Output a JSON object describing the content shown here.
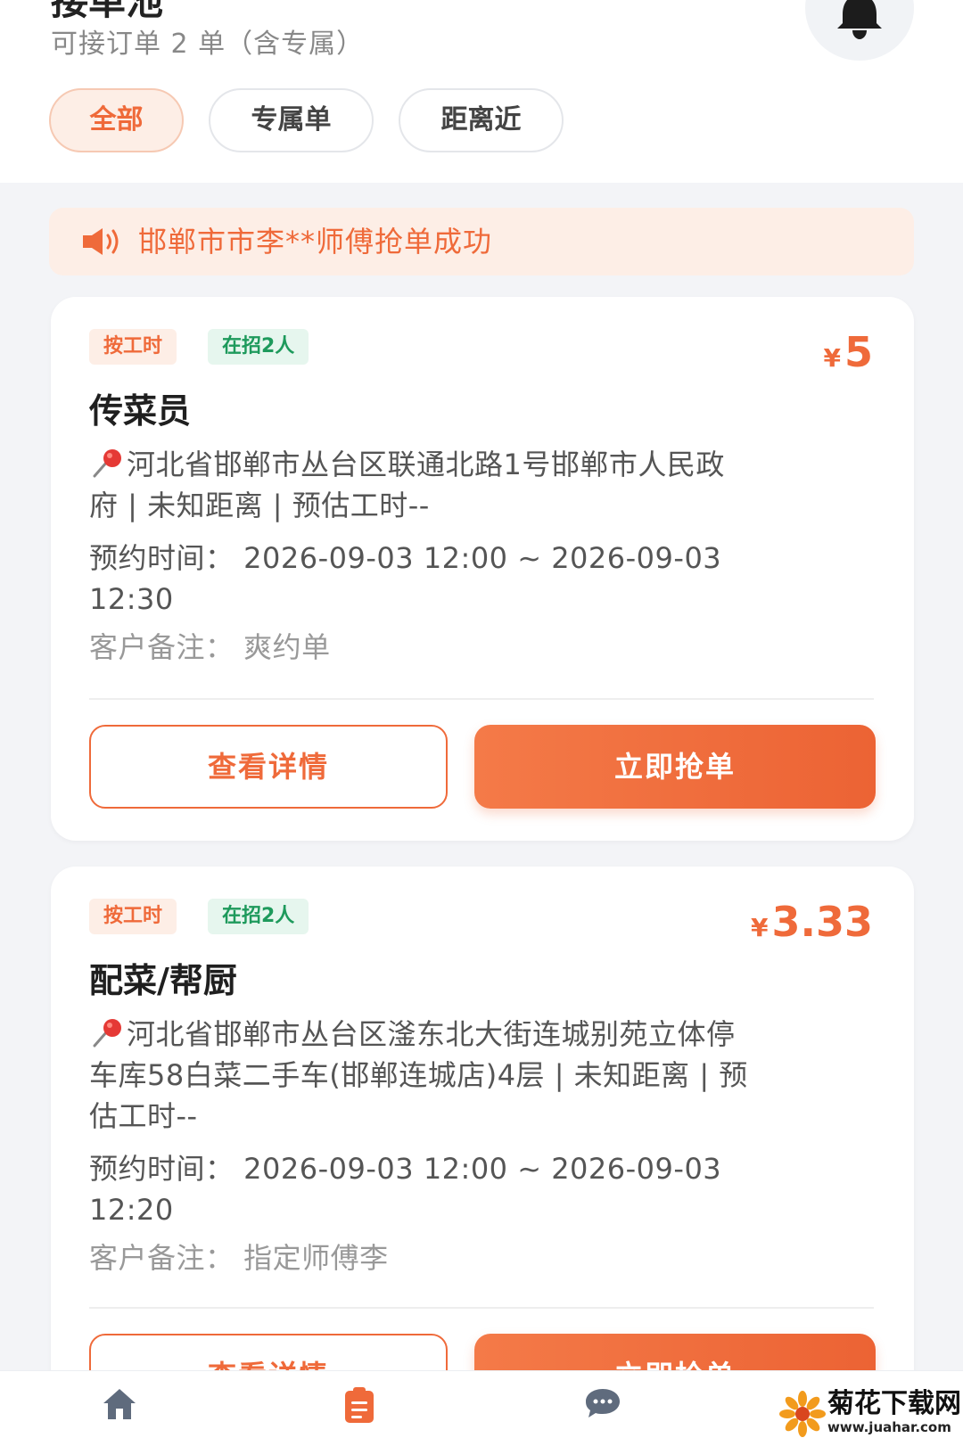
{
  "header": {
    "title": "接单池",
    "subtitle": "可接订单 2 单（含专属）",
    "bell_icon": "bell-icon",
    "filters": [
      {
        "label": "全部",
        "active": true
      },
      {
        "label": "专属单",
        "active": false
      },
      {
        "label": "距离近",
        "active": false
      }
    ]
  },
  "notice": {
    "icon": "speaker-icon",
    "text": "邯郸市市李**师傅抢单成功"
  },
  "orders": [
    {
      "tag_type": "按工时",
      "tag_hiring": "在招2人",
      "currency": "¥",
      "price": "5",
      "title": "传菜员",
      "address_line1": "河北省邯郸市丛台区联通北路1号邯郸市人民政",
      "address_line2": "府 | 未知距离 | 预估工时--",
      "time_line1": "预约时间：  2026-09-03 12:00 ~ 2026-09-03",
      "time_line2": "12:30",
      "note": "客户备注：  爽约单",
      "detail_label": "查看详情",
      "grab_label": "立即抢单"
    },
    {
      "tag_type": "按工时",
      "tag_hiring": "在招2人",
      "currency": "¥",
      "price": "3.33",
      "title": "配菜/帮厨",
      "address_line1": "河北省邯郸市丛台区滏东北大街连城别苑立体停",
      "address_line2": "车库58白菜二手车(邯郸连城店)4层 | 未知距离 | 预",
      "address_line3": "估工时--",
      "time_line1": "预约时间：  2026-09-03 12:00 ~ 2026-09-03",
      "time_line2": "12:20",
      "note": "客户备注：  指定师傅李",
      "detail_label": "查看详情",
      "grab_label": "立即抢单"
    }
  ],
  "bottom_nav": {
    "items": [
      {
        "icon": "home-icon",
        "active": false
      },
      {
        "icon": "orders-icon",
        "active": true
      },
      {
        "icon": "chat-icon",
        "active": false
      }
    ]
  },
  "watermark": {
    "title": "菊花下载网",
    "url": "www.juahar.com"
  },
  "colors": {
    "accent": "#ef6a3a",
    "accent_bg": "#fdeee6",
    "green": "#1e9a5c",
    "page_bg": "#f3f4f7"
  }
}
